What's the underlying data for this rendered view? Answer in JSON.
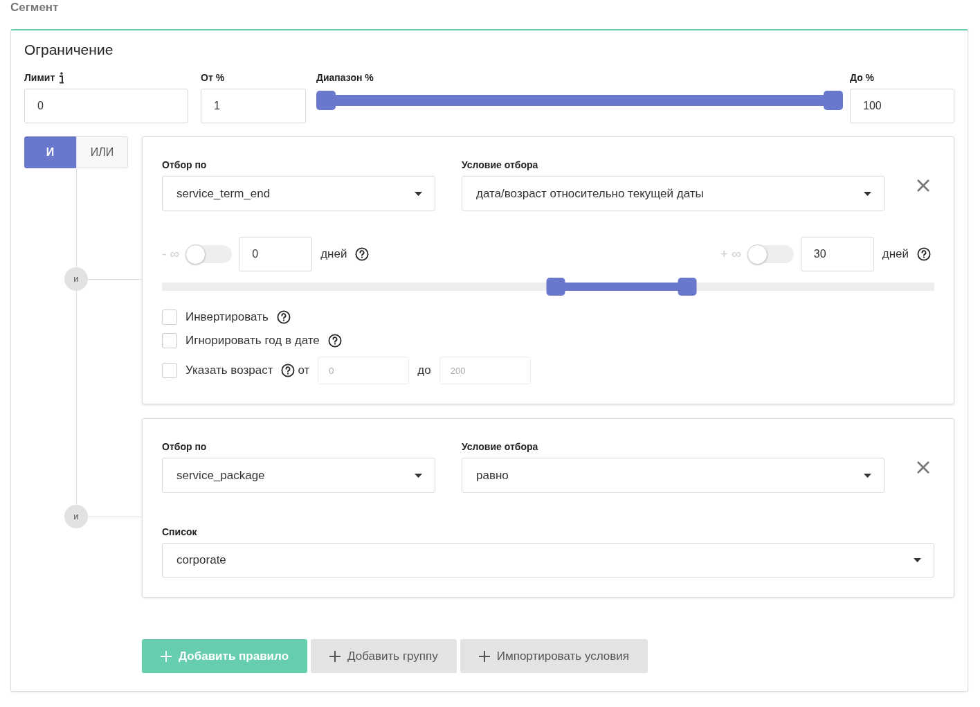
{
  "page_title": "Сегмент",
  "limit_section": {
    "title": "Ограничение",
    "limit": {
      "label": "Лимит",
      "value": "0"
    },
    "from": {
      "label": "От %",
      "value": "1"
    },
    "range": {
      "label": "Диапазон %",
      "thumbs": [
        {
          "level": 0
        },
        {
          "level": 1
        }
      ]
    },
    "to": {
      "label": "До %",
      "value": "100"
    }
  },
  "logic": [
    {
      "label": "И",
      "selected": true
    },
    {
      "label": "ИЛИ",
      "selected": false
    }
  ],
  "rules": [
    {
      "kind": "date",
      "connector": "и",
      "field": {
        "label": "Отбор по",
        "value": "service_term_end"
      },
      "condition": {
        "label": "Условие отбора",
        "value": "дата/возраст относительно текущей даты"
      },
      "bounds": [
        {
          "kind": "lower",
          "symbol": "- ∞",
          "on": false,
          "value": "0",
          "unit": "дней"
        },
        {
          "kind": "upper",
          "symbol": "+ ∞",
          "on": false,
          "value": "30",
          "unit": "дней"
        }
      ],
      "slider": {
        "thumbs": [
          {
            "level": 0.51
          },
          {
            "level": 0.68
          }
        ]
      },
      "options": [
        {
          "label": "Инвертировать",
          "checked": false
        },
        {
          "label": "Игнорировать год в дате",
          "checked": false
        },
        {
          "label": "Указать возраст",
          "checked": false,
          "from_label": "от",
          "from_placeholder": "0",
          "to_label": "до",
          "to_placeholder": "200"
        }
      ]
    },
    {
      "kind": "list",
      "connector": "и",
      "field": {
        "label": "Отбор по",
        "value": "service_package"
      },
      "condition": {
        "label": "Условие отбора",
        "value": "равно"
      },
      "list": {
        "label": "Список",
        "value": "corporate"
      }
    }
  ],
  "buttons": [
    {
      "kind": "primary",
      "label": "Добавить правило"
    },
    {
      "kind": "secondary",
      "label": "Добавить группу"
    },
    {
      "kind": "secondary",
      "label": "Импортировать условия"
    }
  ]
}
